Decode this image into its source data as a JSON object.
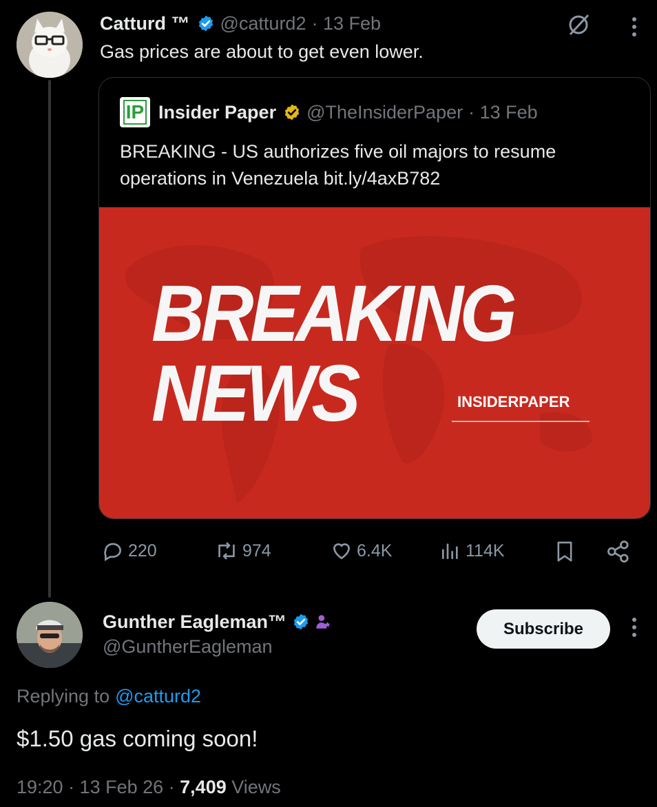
{
  "tweet1": {
    "author_name": "Catturd ™",
    "handle": "@catturd2",
    "date": "· 13 Feb",
    "text": "Gas prices are about to get even lower."
  },
  "quote": {
    "logo_text": "IP",
    "author_name": "Insider Paper",
    "handle": "@TheInsiderPaper",
    "date": "· 13 Feb",
    "text": "BREAKING - US authorizes five oil majors to resume operations in Venezuela bit.ly/4axB782",
    "image": {
      "line1": "BREAKING",
      "line2": "NEWS",
      "brand": "INSIDERPAPER",
      "background_color": "#c8291f"
    }
  },
  "actions": {
    "replies": "220",
    "reposts": "974",
    "likes": "6.4K",
    "views": "114K"
  },
  "tweet2": {
    "author_name": "Gunther Eagleman™",
    "handle": "@GuntherEagleman",
    "subscribe_label": "Subscribe",
    "replying_prefix": "Replying to",
    "replying_handle": "@catturd2",
    "text": "$1.50 gas coming soon!",
    "time": "19:20 · 13 Feb 26 · ",
    "views_count": "7,409",
    "views_label": " Views"
  },
  "colors": {
    "accent": "#1d9bf0",
    "gold_badge": "#e2b719",
    "background": "#000000",
    "muted_text": "#71767b"
  },
  "icons": [
    "verified-icon",
    "grok-icon",
    "more-icon",
    "reply-icon",
    "repost-icon",
    "like-icon",
    "views-icon",
    "bookmark-icon",
    "share-icon",
    "affiliate-icon"
  ]
}
